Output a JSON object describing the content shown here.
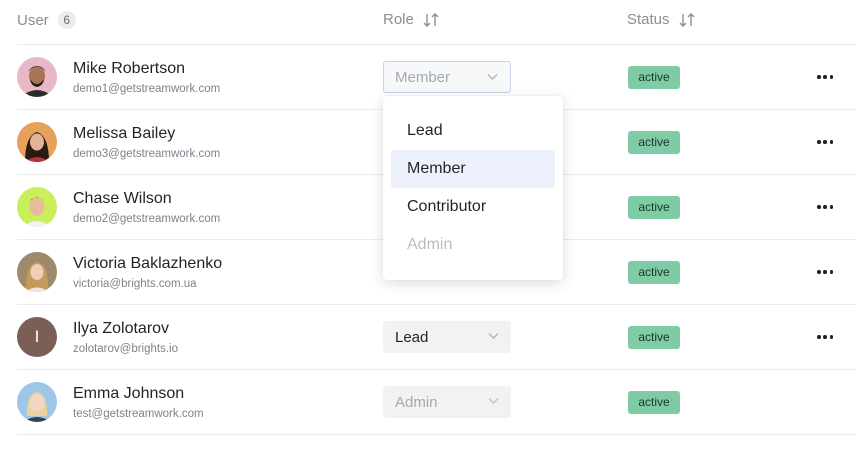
{
  "header": {
    "user_label": "User",
    "user_count": "6",
    "role_label": "Role",
    "status_label": "Status"
  },
  "users": [
    {
      "name": "Mike Robertson",
      "email": "demo1@getstreamwork.com",
      "role": "Member",
      "status": "active",
      "avatar": "photo"
    },
    {
      "name": "Melissa Bailey",
      "email": "demo3@getstreamwork.com",
      "role": "",
      "status": "active",
      "avatar": "photo"
    },
    {
      "name": "Chase Wilson",
      "email": "demo2@getstreamwork.com",
      "role": "",
      "status": "active",
      "avatar": "photo"
    },
    {
      "name": "Victoria Baklazhenko",
      "email": "victoria@brights.com.ua",
      "role": "",
      "status": "active",
      "avatar": "photo"
    },
    {
      "name": "Ilya Zolotarov",
      "email": "zolotarov@brights.io",
      "role": "Lead",
      "status": "active",
      "avatar_letter": "I"
    },
    {
      "name": "Emma Johnson",
      "email": "test@getstreamwork.com",
      "role": "Admin",
      "status": "active",
      "avatar": "photo"
    }
  ],
  "role_dropdown": {
    "options": [
      "Lead",
      "Member",
      "Contributor",
      "Admin"
    ],
    "selected": "Member",
    "disabled": "Admin"
  },
  "colors": {
    "status_active": "#7ecba6",
    "selected_option": "#edf1fc",
    "select_bg": "#f1f2f1",
    "divider": "#ebebeb"
  },
  "icons": {
    "sort": "sort-arrows-icon",
    "chevron": "chevron-down-icon",
    "more": "more-horizontal-icon"
  }
}
